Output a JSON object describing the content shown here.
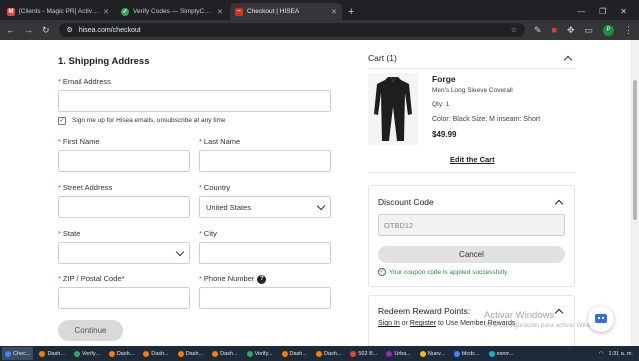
{
  "browser": {
    "tabs": [
      {
        "title": "[Clients - Magic PR] Activate tu",
        "favicon": "gmail-icon",
        "color": "#ea4335",
        "active": false
      },
      {
        "title": "Verify Codes — SimplyCodes",
        "favicon": "simplycodes-icon",
        "color": "#34a853",
        "active": false
      },
      {
        "title": "Checkout | HISEA",
        "favicon": "hisea-icon",
        "color": "#d93025",
        "active": true
      }
    ],
    "new_tab": "+",
    "url": "hisea.com/checkout"
  },
  "shipping": {
    "title": "1. Shipping Address",
    "email_label": "Email Address",
    "email_value": "",
    "subscribe_label": "Sign me up for Hisea emails, unsubscribe at any time",
    "first_name_label": "First Name",
    "last_name_label": "Last Name",
    "street_label": "Street Address",
    "country_label": "Country",
    "country_value": "United States",
    "state_label": "State",
    "state_value": "",
    "city_label": "City",
    "zip_label": "ZIP / Postal Code*",
    "phone_label": "Phone Number",
    "required_mark": "*",
    "continue_label": "Continue"
  },
  "cart": {
    "title": "Cart (1)",
    "item": {
      "name": "Forge",
      "description": "Men's Long Sleeve Coverall",
      "qty": "Qty: 1",
      "attributes": "Color:  Black  Size:  M  inseam:  Short",
      "price": "$49.99"
    },
    "edit_label": "Edit the Cart"
  },
  "discount": {
    "title": "Discount Code",
    "code": "OTBD12",
    "cancel_label": "Cancel",
    "success_message": "Your coupon code is applied successfully."
  },
  "rewards": {
    "title": "Redeem Reward Points:",
    "sign_in": "Sign In",
    "or": " or ",
    "register": "Register",
    "suffix": " to Use Member Rewards"
  },
  "watermark": {
    "line1": "Activar Windows",
    "line2": "Ve a Configuración para activar Windows."
  },
  "taskbar": {
    "items": [
      {
        "label": "Chec...",
        "color": "#4285f4",
        "active": true
      },
      {
        "label": "Dash...",
        "color": "#ff7a00",
        "active": false
      },
      {
        "label": "Verify...",
        "color": "#34a853",
        "active": false
      },
      {
        "label": "Dash...",
        "color": "#ff7a00",
        "active": false
      },
      {
        "label": "Dash...",
        "color": "#ff7a00",
        "active": false
      },
      {
        "label": "Dash...",
        "color": "#ff7a00",
        "active": false
      },
      {
        "label": "Dash...",
        "color": "#ff7a00",
        "active": false
      },
      {
        "label": "Verify...",
        "color": "#34a853",
        "active": false
      },
      {
        "label": "Dash...",
        "color": "#ff7a00",
        "active": false
      },
      {
        "label": "Dash...",
        "color": "#ff7a00",
        "active": false
      },
      {
        "label": "502 B...",
        "color": "#ea4335",
        "active": false
      },
      {
        "label": "Urba...",
        "color": "#9c27b0",
        "active": false
      },
      {
        "label": "Nuev...",
        "color": "#fbbc05",
        "active": false
      },
      {
        "label": "bfcdc...",
        "color": "#4285f4",
        "active": false
      },
      {
        "label": "esnrr...",
        "color": "#00bcd4",
        "active": false
      }
    ],
    "time": "1:31 a. m."
  }
}
